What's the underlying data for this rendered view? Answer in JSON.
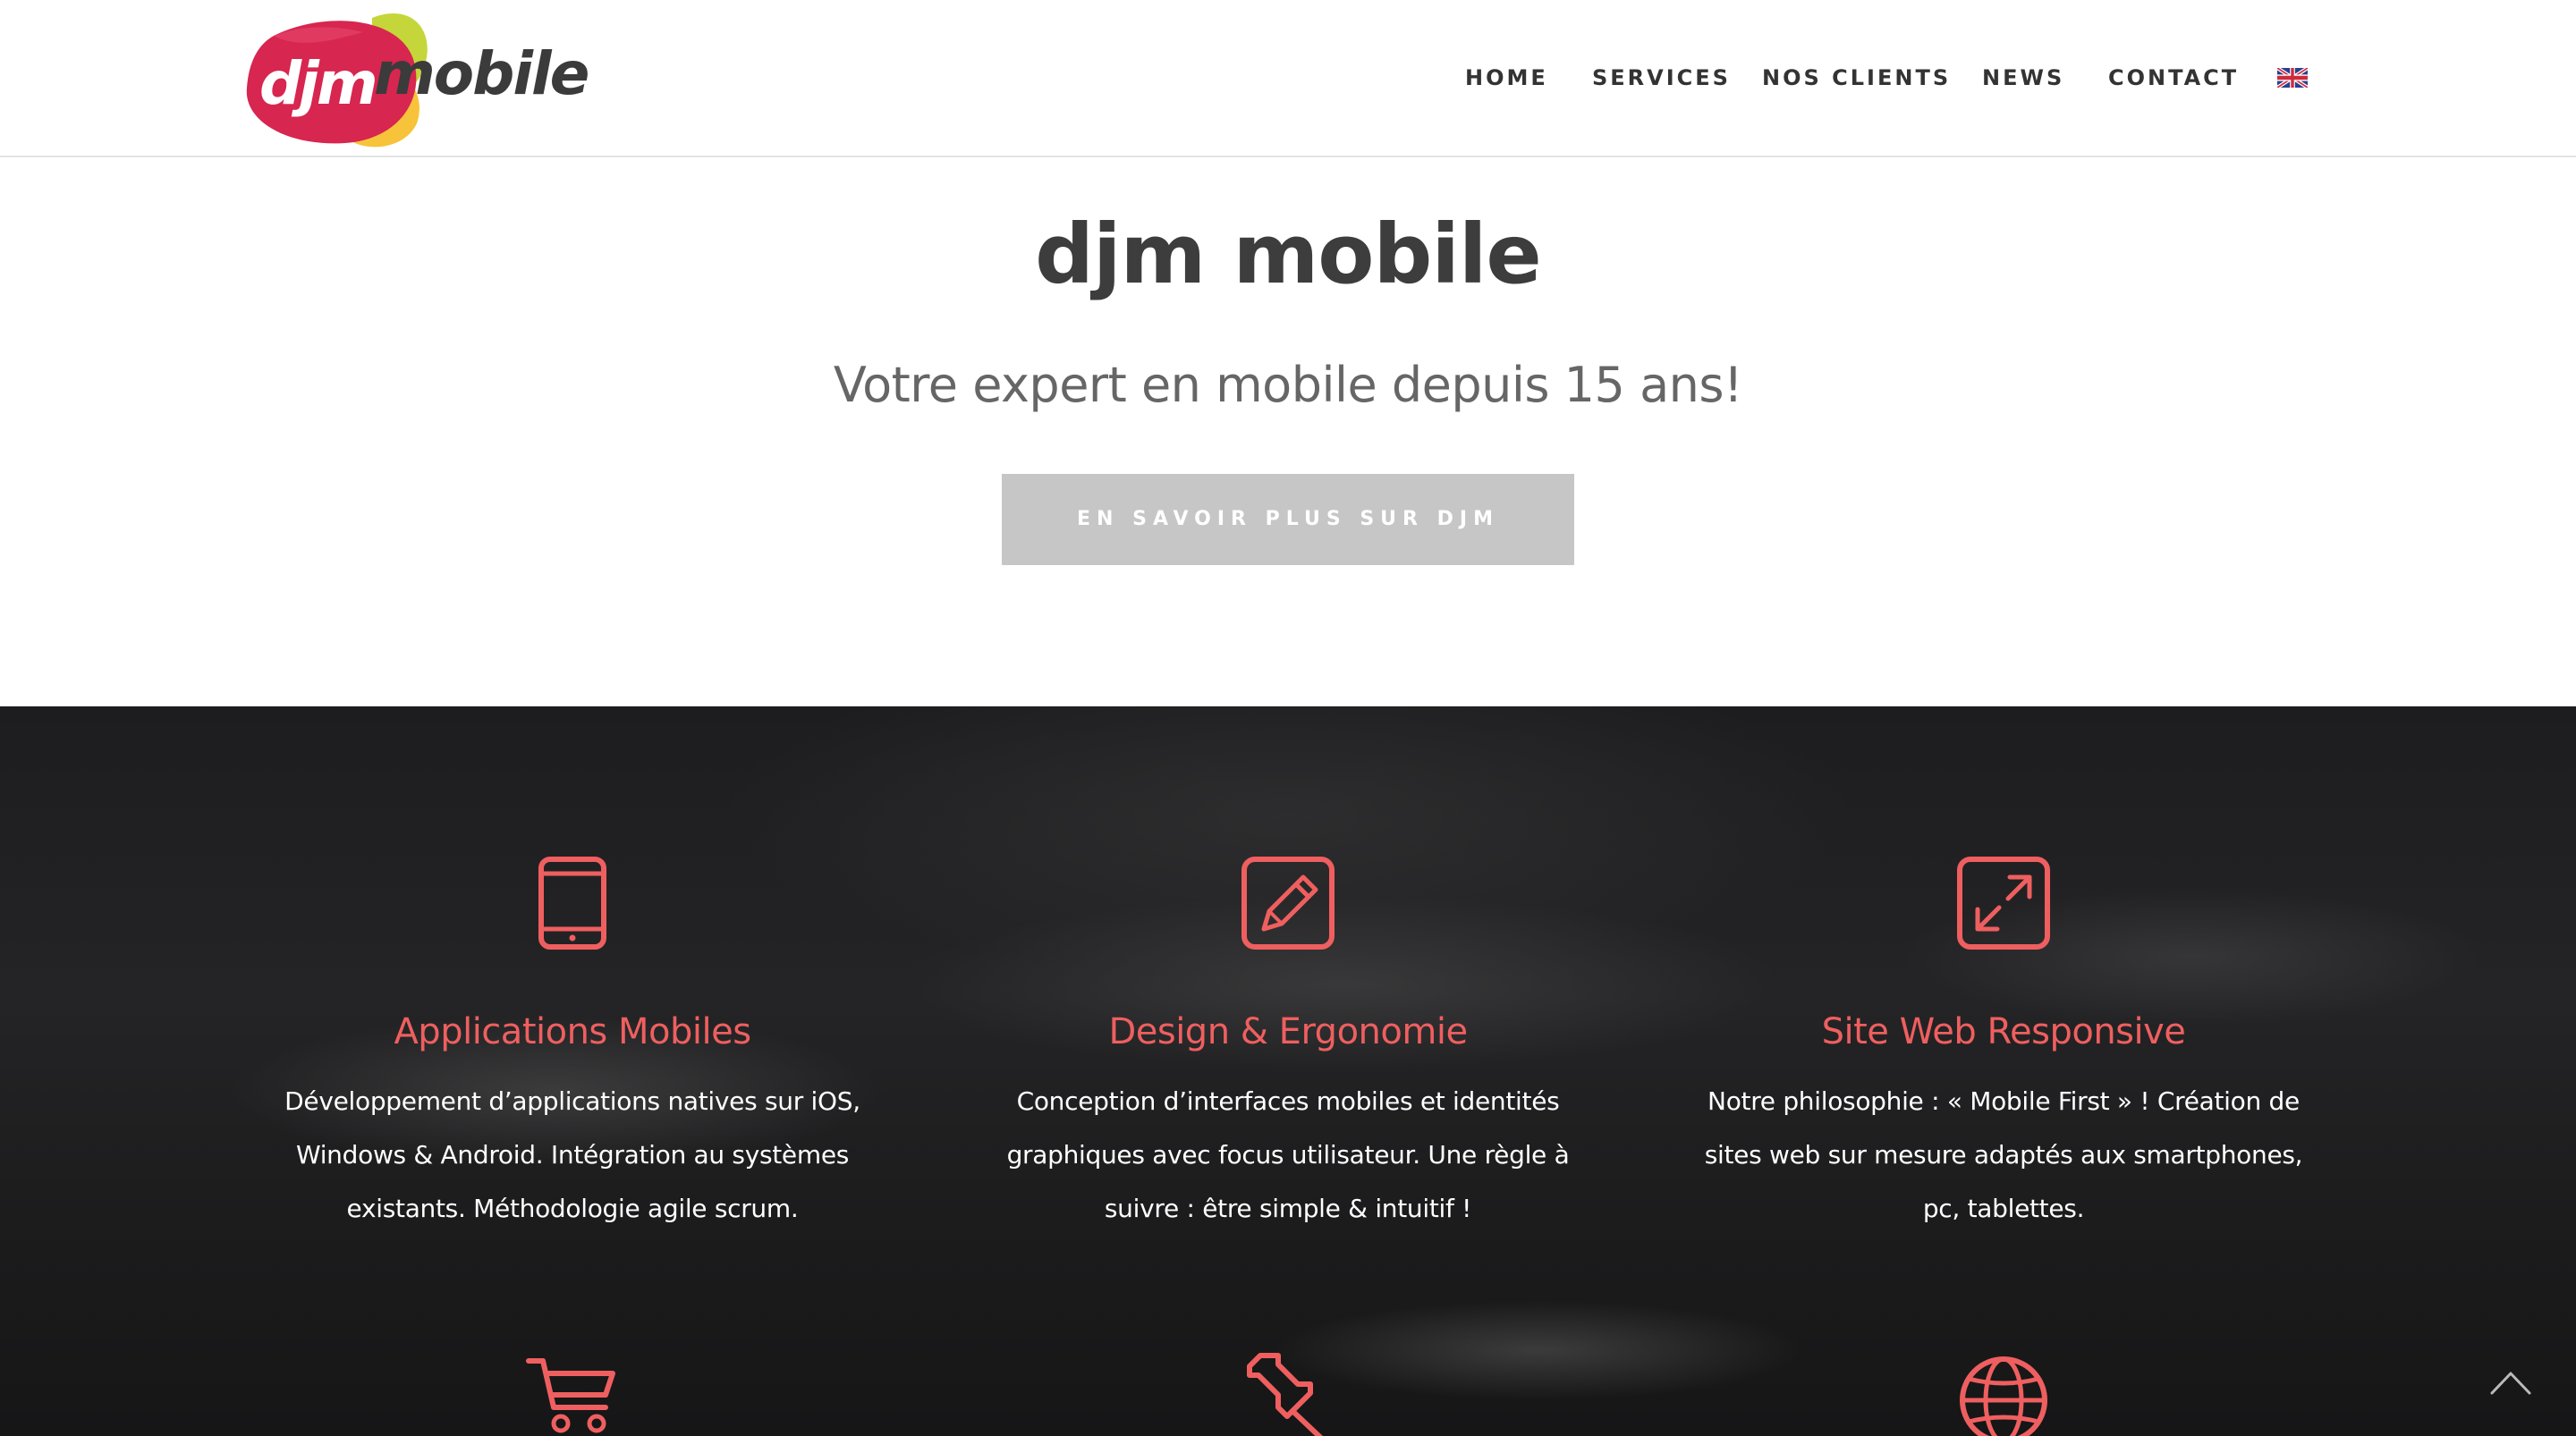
{
  "header": {
    "logo": {
      "mark": "djm",
      "name": "mobile"
    },
    "nav": [
      {
        "label": "HOME"
      },
      {
        "label": "SERVICES"
      },
      {
        "label": "NOS CLIENTS"
      },
      {
        "label": "NEWS"
      },
      {
        "label": "CONTACT"
      }
    ],
    "language_flag": "uk-flag-icon"
  },
  "hero": {
    "title": "djm mobile",
    "subtitle": "Votre expert en mobile depuis 15 ans!",
    "button_label": "EN SAVOIR PLUS SUR DJM"
  },
  "services": [
    {
      "icon": "tablet-icon",
      "title": "Applications Mobiles",
      "lines": [
        "Développement d’applications natives sur iOS,",
        "Windows & Android. Intégration au systèmes",
        "existants. Méthodologie agile scrum."
      ]
    },
    {
      "icon": "pencil-edit-icon",
      "title": "Design & Ergonomie",
      "lines": [
        "Conception d’interfaces mobiles et identités",
        "graphiques avec focus utilisateur. Une règle à",
        "suivre : être simple & intuitif !"
      ]
    },
    {
      "icon": "expand-arrows-icon",
      "title": "Site Web Responsive",
      "lines": [
        "Notre philosophie : « Mobile First » ! Création de",
        "sites web sur mesure adaptés aux smartphones,",
        "pc, tablettes."
      ]
    }
  ],
  "services_row2_icons": [
    "cart-icon",
    "pin-icon",
    "globe-icon"
  ],
  "colors": {
    "accent": "#ef5f5f",
    "logo_red": "#d7264f",
    "logo_yellow": "#f7c33a",
    "logo_green": "#c5d63a",
    "button_gray": "#c6c6c6",
    "dark_bg": "#1e1e20"
  }
}
